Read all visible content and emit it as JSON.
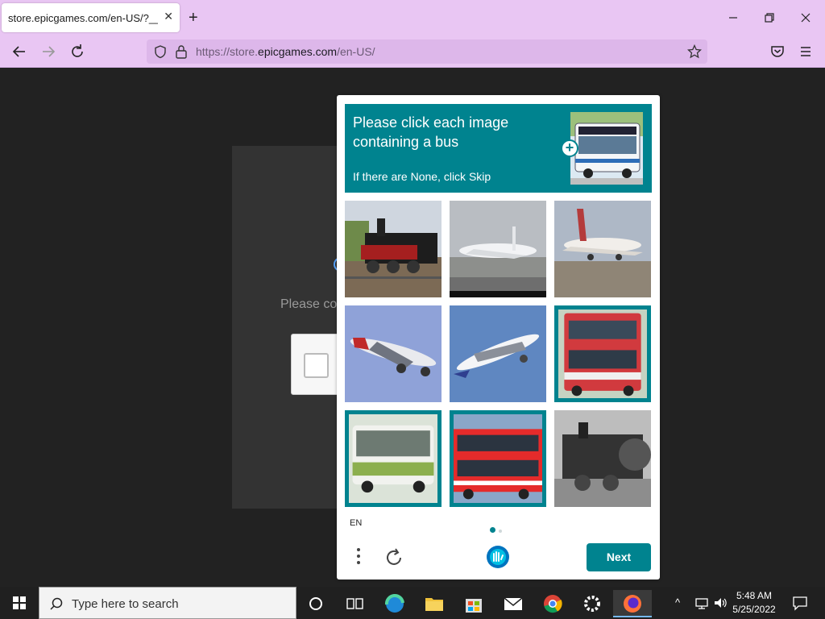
{
  "browser": {
    "tab_title": "store.epicgames.com/en-US/?__cf_",
    "url_prefix": "https://store.",
    "url_domain": "epicgames.com",
    "url_suffix": "/en-US/",
    "window_controls": [
      "minimize-icon",
      "restore-icon",
      "close-icon"
    ]
  },
  "page": {
    "status_text": "Please co"
  },
  "captcha": {
    "prompt_line": "Please click each image containing a bus",
    "prompt_sub": "If there are None, click Skip",
    "accent_color": "#00838f",
    "tiles": [
      {
        "content": "steam train",
        "selected": false
      },
      {
        "content": "airplane on runway",
        "selected": false
      },
      {
        "content": "airplane at airport",
        "selected": false
      },
      {
        "content": "airplane in sky",
        "selected": false
      },
      {
        "content": "airplane in sky",
        "selected": false
      },
      {
        "content": "double-decker bus",
        "selected": true
      },
      {
        "content": "city bus",
        "selected": true
      },
      {
        "content": "red double-decker bus",
        "selected": true
      },
      {
        "content": "steam locomotive",
        "selected": false
      }
    ],
    "language": "EN",
    "next_label": "Next"
  },
  "taskbar": {
    "search_placeholder": "Type here to search",
    "time": "5:48 AM",
    "date": "5/25/2022",
    "apps": [
      "task-view-icon",
      "edge-icon",
      "file-explorer-icon",
      "store-icon",
      "mail-icon",
      "chrome-icon",
      "settings-icon",
      "firefox-icon"
    ]
  }
}
